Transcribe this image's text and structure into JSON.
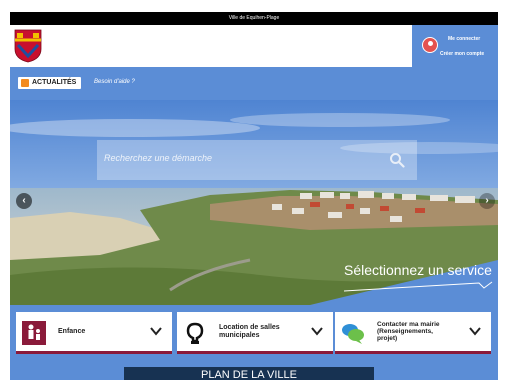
{
  "topbar": {
    "title": "Ville de Equihen-Plage"
  },
  "account": {
    "login_label": "Me connecter",
    "create_label": "Créer mon compte"
  },
  "newsbar": {
    "news_label": "ACTUALITÉS",
    "help_label": "Besoin d'aide ?"
  },
  "search": {
    "placeholder": "Recherchez une démarche"
  },
  "hero": {
    "service_title": "Sélectionnez un service"
  },
  "cards": [
    {
      "label": "Enfance",
      "icon": "child-icon"
    },
    {
      "label": "Location de salles municipales",
      "icon": "room-icon"
    },
    {
      "label": "Contacter ma mairie (Renseignements, projet)",
      "icon": "chat-bubbles-icon"
    }
  ],
  "plan": {
    "label": "PLAN DE LA VILLE"
  },
  "colors": {
    "accent": "#5b8dd6",
    "card_border": "#8a1a3a",
    "dark": "#173252",
    "user_icon": "#e4524f"
  }
}
